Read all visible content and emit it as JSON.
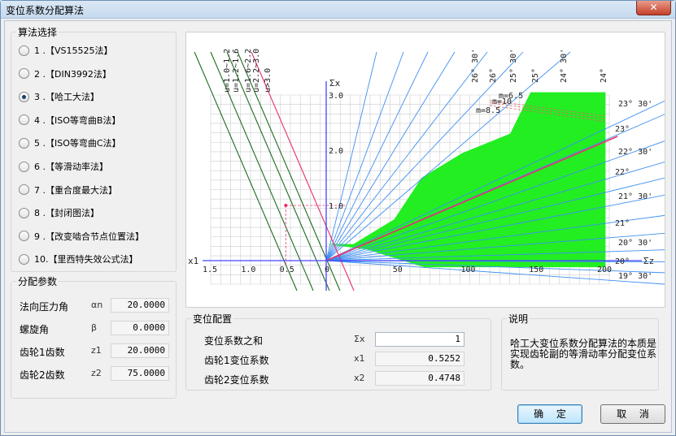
{
  "window": {
    "title": "变位系数分配算法",
    "close_label": "✕"
  },
  "methods": {
    "group_label": "算法选择",
    "selected_index": 2,
    "items": [
      "1 .【VS15525法】",
      "2 .【DIN3992法】",
      "3 .【哈工大法】",
      "4 .【ISO等弯曲B法】",
      "5 .【ISO等弯曲C法】",
      "6 .【等滑动率法】",
      "7 .【重合度最大法】",
      "8 .【封闭图法】",
      "9 .【改变啮合节点位置法】",
      "10.【里西特失效公式法】"
    ]
  },
  "params": {
    "group_label": "分配参数",
    "rows": [
      {
        "label": "法向压力角",
        "symbol": "αn",
        "value": "20.0000"
      },
      {
        "label": "螺旋角",
        "symbol": "β",
        "value": "0.0000"
      },
      {
        "label": "齿轮1齿数",
        "symbol": "z1",
        "value": "20.0000"
      },
      {
        "label": "齿轮2齿数",
        "symbol": "z2",
        "value": "75.0000"
      }
    ]
  },
  "config": {
    "group_label": "变位配置",
    "rows": [
      {
        "label": "变位系数之和",
        "symbol": "Σx",
        "value": "1"
      },
      {
        "label": "齿轮1变位系数",
        "symbol": "x1",
        "value": "0.5252"
      },
      {
        "label": "齿轮2变位系数",
        "symbol": "x2",
        "value": "0.4748"
      }
    ]
  },
  "explain": {
    "group_label": "说明",
    "text": "哈工大变位系数分配算法的本质是实现齿轮副的等滑动率分配变位系数。"
  },
  "buttons": {
    "ok": "确 定",
    "cancel": "取 消"
  },
  "colors": {
    "region_fill": "#22ee22",
    "grid": "#cccccc",
    "axis": "#4444ff",
    "ray": "#3d8ff2",
    "highlight": "#e8306a",
    "dark_line": "#1f6b1f"
  },
  "chart_data": {
    "type": "diagram",
    "x_axis_right_label": "Σz",
    "x_axis_left_label": "x1",
    "y_axis_label": "Σx",
    "right_ticks": [
      "0",
      "50",
      "100",
      "150",
      "200"
    ],
    "right_range": [
      0,
      200
    ],
    "left_ticks": [
      "1.5",
      "1.0",
      "0.5"
    ],
    "left_range": [
      0,
      1.5
    ],
    "y_ticks": [
      "1.0",
      "2.0",
      "3.0"
    ],
    "y_range": [
      0,
      3.0
    ],
    "top_angle_labels": [
      "26° 30'",
      "26°",
      "25° 30'",
      "25°",
      "24° 30'",
      "24°"
    ],
    "right_angle_labels": [
      "23° 30'",
      "23°",
      "22° 30'",
      "22°",
      "21° 30'",
      "21°",
      "20° 30'",
      "20°",
      "19° 30'"
    ],
    "u_labels": [
      "u=1.0~1.2",
      "u=1.2~1.6",
      "u=1.6~2.2",
      "u=2.2~3.0",
      "u>3.0"
    ],
    "m_labels": [
      "m=6.5",
      "m=10",
      "m=8.5"
    ],
    "selected_point": {
      "x1": 0.5252,
      "sum_x": 1.0
    }
  }
}
